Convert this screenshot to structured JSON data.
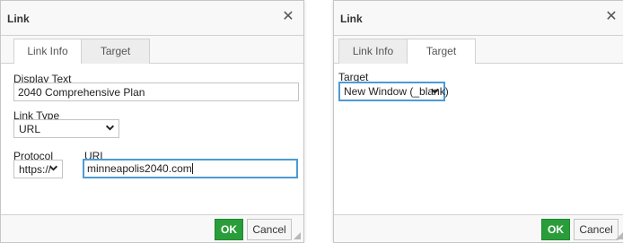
{
  "dialogs": [
    {
      "title": "Link",
      "tabs": [
        {
          "label": "Link Info",
          "active": true
        },
        {
          "label": "Target",
          "active": false
        }
      ],
      "display_text": {
        "label": "Display Text",
        "value": "2040 Comprehensive Plan"
      },
      "link_type": {
        "label": "Link Type",
        "selected": "URL"
      },
      "protocol": {
        "label": "Protocol",
        "selected": "https://"
      },
      "url": {
        "label": "URL",
        "value": "minneapolis2040.com"
      },
      "buttons": {
        "ok": "OK",
        "cancel": "Cancel"
      }
    },
    {
      "title": "Link",
      "tabs": [
        {
          "label": "Link Info",
          "active": false
        },
        {
          "label": "Target",
          "active": true
        }
      ],
      "target": {
        "label": "Target",
        "selected": "New Window (_blank)"
      },
      "buttons": {
        "ok": "OK",
        "cancel": "Cancel"
      }
    }
  ],
  "icons": {
    "close": "close-icon",
    "dropdown": "chevron-down-icon",
    "resize": "resize-grip-icon"
  },
  "colors": {
    "ok_button": "#2a9d3b",
    "focus_border": "#4b9bd7",
    "header_bg": "#f8f8f8"
  }
}
